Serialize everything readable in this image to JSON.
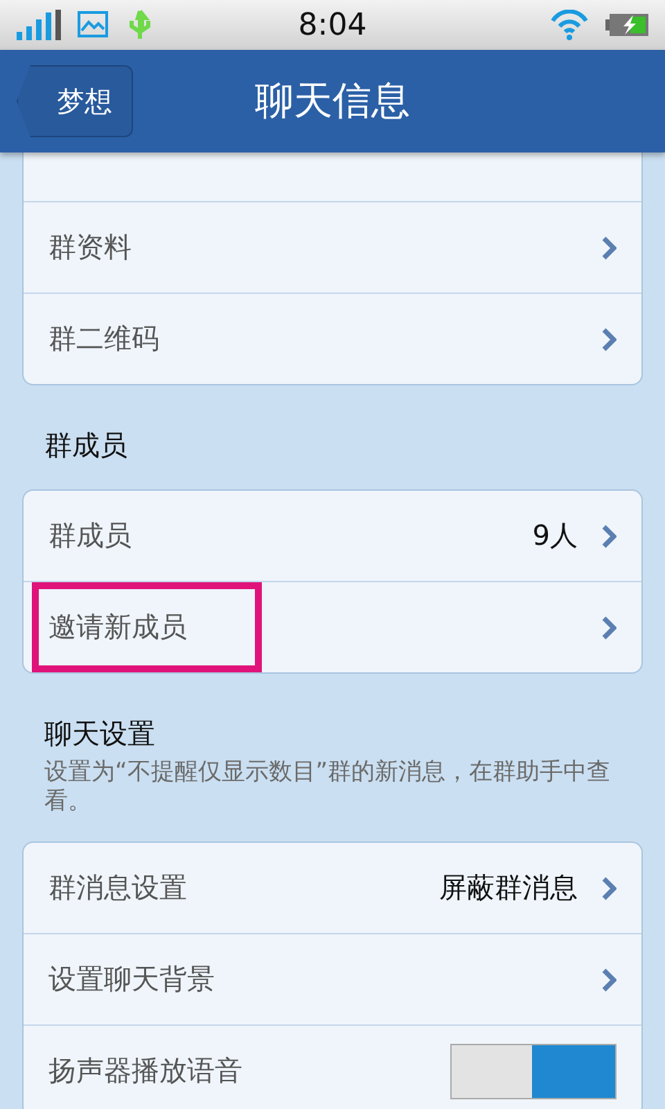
{
  "status_bar": {
    "time": "8:04"
  },
  "header": {
    "back": "梦想",
    "title": "聊天信息"
  },
  "sections": [
    {
      "rows": [
        {
          "kind": "cut"
        },
        {
          "kind": "link",
          "label": "群资料"
        },
        {
          "kind": "link",
          "label": "群二维码"
        }
      ]
    },
    {
      "title": "群成员",
      "rows": [
        {
          "kind": "link",
          "label": "群成员",
          "value": "9人"
        },
        {
          "kind": "link",
          "label": "邀请新成员",
          "highlighted": true
        }
      ]
    },
    {
      "title": "聊天设置",
      "note": "设置为“不提醒仅显示数目”群的新消息，在群助手中查看。",
      "rows": [
        {
          "kind": "link",
          "label": "群消息设置",
          "value": "屏蔽群消息"
        },
        {
          "kind": "link",
          "label": "设置聊天背景"
        },
        {
          "kind": "toggle",
          "label": "扬声器播放语音",
          "on": true
        }
      ]
    }
  ]
}
